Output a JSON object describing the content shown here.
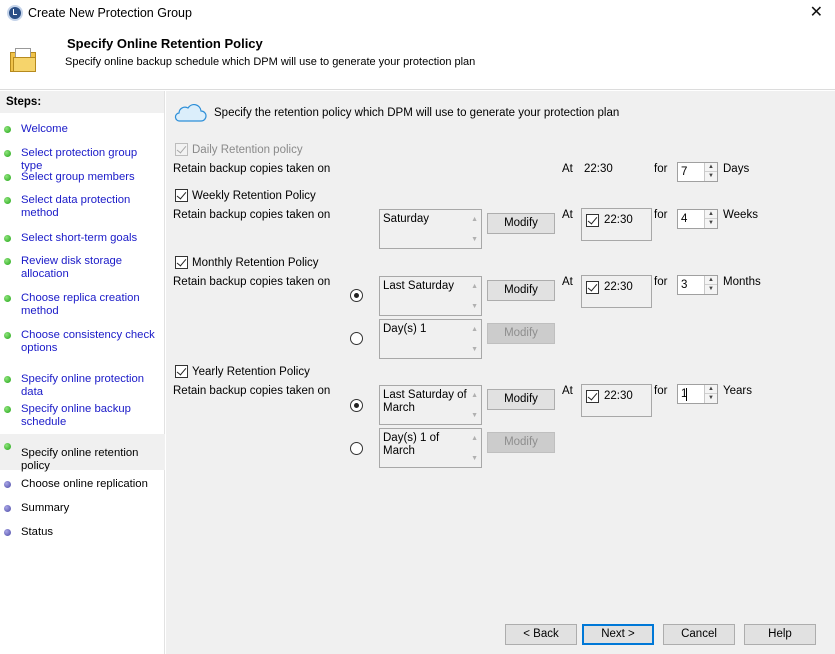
{
  "window": {
    "title": "Create New Protection Group",
    "close_glyph": "✕"
  },
  "header": {
    "title": "Specify Online Retention Policy",
    "subtitle": "Specify online backup schedule which DPM will use to generate your protection plan"
  },
  "steps": {
    "heading": "Steps:",
    "items": [
      {
        "label": "Welcome",
        "status": "done"
      },
      {
        "label": "Select protection group type",
        "status": "done"
      },
      {
        "label": "Select group members",
        "status": "done"
      },
      {
        "label": "Select data protection method",
        "status": "done"
      },
      {
        "label": "Select short-term goals",
        "status": "done"
      },
      {
        "label": "Review disk storage allocation",
        "status": "done"
      },
      {
        "label": "Choose replica creation method",
        "status": "done"
      },
      {
        "label": "Choose consistency check options",
        "status": "done"
      },
      {
        "label": "Specify online protection data",
        "status": "done"
      },
      {
        "label": "Specify online backup schedule",
        "status": "done"
      },
      {
        "label": "Specify online retention policy",
        "status": "current"
      },
      {
        "label": "Choose online replication",
        "status": "pending"
      },
      {
        "label": "Summary",
        "status": "pending"
      },
      {
        "label": "Status",
        "status": "pending"
      }
    ]
  },
  "intro": "Specify the retention policy which DPM will use to generate your protection plan",
  "common": {
    "retain_label": "Retain backup copies taken on",
    "at_label": "At",
    "for_label": "for",
    "modify_label": "Modify"
  },
  "daily": {
    "label": "Daily Retention policy",
    "checked": true,
    "enabled": false,
    "time": "22:30",
    "count": "7",
    "unit": "Days"
  },
  "weekly": {
    "label": "Weekly Retention Policy",
    "checked": true,
    "day": "Saturday",
    "time": "22:30",
    "time_checked": true,
    "count": "4",
    "unit": "Weeks"
  },
  "monthly": {
    "label": "Monthly Retention Policy",
    "checked": true,
    "option1": "Last Saturday",
    "option2": "Day(s) 1",
    "selected_option": 1,
    "time": "22:30",
    "time_checked": true,
    "count": "3",
    "unit": "Months"
  },
  "yearly": {
    "label": "Yearly Retention Policy",
    "checked": true,
    "option1": "Last Saturday of March",
    "option2": "Day(s) 1 of March",
    "selected_option": 1,
    "time": "22:30",
    "time_checked": true,
    "count": "1",
    "unit": "Years"
  },
  "buttons": {
    "back": "< Back",
    "next": "Next >",
    "cancel": "Cancel",
    "help": "Help"
  },
  "colors": {
    "link": "#1a1ac8",
    "done_dot": "#21a615",
    "pending_dot": "#4b4aa6",
    "panel_bg": "#f0f0f0",
    "primary_border": "#0078d7"
  },
  "icons": {
    "app": "dpm-shield-icon",
    "header": "folder-icon",
    "cloud": "cloud-icon"
  }
}
